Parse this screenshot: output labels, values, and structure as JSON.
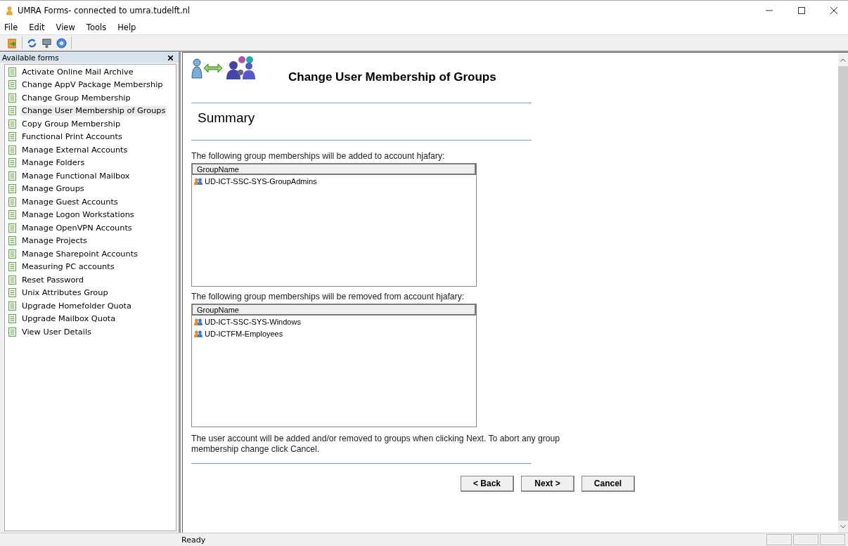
{
  "window": {
    "title": "UMRA Forms- connected to umra.tudelft.nl"
  },
  "menu": [
    "File",
    "Edit",
    "View",
    "Tools",
    "Help"
  ],
  "sidebar": {
    "title": "Available forms",
    "items": [
      {
        "label": "Activate Online Mail Archive",
        "selected": false
      },
      {
        "label": "Change AppV Package Membership",
        "selected": false
      },
      {
        "label": "Change Group Membership",
        "selected": false
      },
      {
        "label": "Change User Membership of Groups",
        "selected": true
      },
      {
        "label": "Copy Group Membership",
        "selected": false
      },
      {
        "label": "Functional Print Accounts",
        "selected": false
      },
      {
        "label": "Manage External Accounts",
        "selected": false
      },
      {
        "label": "Manage Folders",
        "selected": false
      },
      {
        "label": "Manage Functional Mailbox",
        "selected": false
      },
      {
        "label": "Manage Groups",
        "selected": false
      },
      {
        "label": "Manage Guest Accounts",
        "selected": false
      },
      {
        "label": "Manage Logon Workstations",
        "selected": false
      },
      {
        "label": "Manage OpenVPN Accounts",
        "selected": false
      },
      {
        "label": "Manage Projects",
        "selected": false
      },
      {
        "label": "Manage Sharepoint Accounts",
        "selected": false
      },
      {
        "label": "Measuring PC accounts",
        "selected": false
      },
      {
        "label": "Reset Password",
        "selected": false
      },
      {
        "label": "Unix Attributes Group",
        "selected": false
      },
      {
        "label": "Upgrade Homefolder Quota",
        "selected": false
      },
      {
        "label": "Upgrade Mailbox Quota",
        "selected": false
      },
      {
        "label": "View User Details",
        "selected": false
      }
    ]
  },
  "form": {
    "title": "Change User Membership of Groups",
    "section": "Summary",
    "lists": [
      {
        "intro": "The following group memberships will be added to account hjafary:",
        "column": "GroupName",
        "rows": [
          "UD-ICT-SSC-SYS-GroupAdmins"
        ]
      },
      {
        "intro": "The following group memberships will be removed from account hjafary:",
        "column": "GroupName",
        "rows": [
          "UD-ICT-SSC-SYS-Windows",
          "UD-ICTFM-Employees"
        ]
      }
    ],
    "note": "The user account will be added and/or removed to groups when clicking Next. To abort any group membership change click Cancel.",
    "buttons": [
      "< Back",
      "Next >",
      "Cancel"
    ]
  },
  "status_bar": {
    "text": "Ready"
  }
}
